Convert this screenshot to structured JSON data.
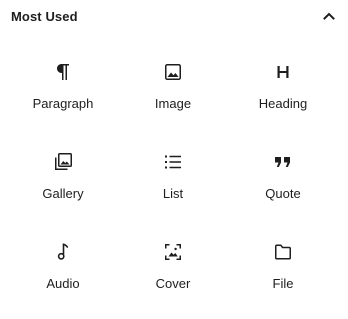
{
  "panel": {
    "title": "Most Used",
    "toggle_icon": "chevron-up-icon"
  },
  "blocks": [
    {
      "label": "Paragraph",
      "icon": "paragraph-icon"
    },
    {
      "label": "Image",
      "icon": "image-icon"
    },
    {
      "label": "Heading",
      "icon": "heading-icon"
    },
    {
      "label": "Gallery",
      "icon": "gallery-icon"
    },
    {
      "label": "List",
      "icon": "list-icon"
    },
    {
      "label": "Quote",
      "icon": "quote-icon"
    },
    {
      "label": "Audio",
      "icon": "audio-icon"
    },
    {
      "label": "Cover",
      "icon": "cover-icon"
    },
    {
      "label": "File",
      "icon": "file-icon"
    }
  ],
  "colors": {
    "text": "#1e1e1e",
    "icon": "#1e1e1e",
    "background": "#ffffff"
  }
}
